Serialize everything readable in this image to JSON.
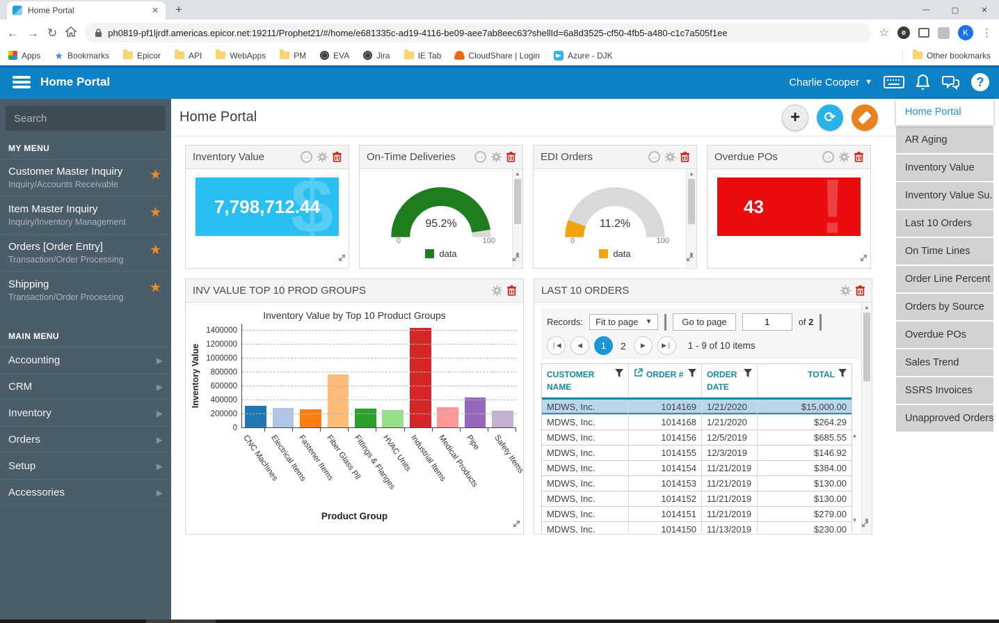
{
  "browser": {
    "tab_title": "Home Portal",
    "url": "ph0819-pf1ljrdf.americas.epicor.net:19211/Prophet21/#/home/e681335c-ad19-4116-be09-aee7ab8eec63?shellId=6a8d3525-cf50-4fb5-a480-c1c7a505f1ee",
    "avatar_letter": "K",
    "extension_letter": "e",
    "bookmarks": [
      {
        "label": "Apps",
        "icon": "apps-grid"
      },
      {
        "label": "Bookmarks",
        "icon": "star-blue"
      },
      {
        "label": "Epicor",
        "icon": "folder"
      },
      {
        "label": "API",
        "icon": "folder"
      },
      {
        "label": "WebApps",
        "icon": "folder"
      },
      {
        "label": "PM",
        "icon": "folder"
      },
      {
        "label": "EVA",
        "icon": "globe"
      },
      {
        "label": "Jira",
        "icon": "globe"
      },
      {
        "label": "IE Tab",
        "icon": "folder"
      },
      {
        "label": "CloudShare | Login",
        "icon": "cloudshare"
      },
      {
        "label": "Azure - DJK",
        "icon": "azure"
      }
    ],
    "other_bookmarks": "Other bookmarks"
  },
  "app_header": {
    "title": "Home Portal",
    "user": "Charlie Cooper"
  },
  "sidebar": {
    "search_placeholder": "Search",
    "my_menu_title": "MY MENU",
    "my_menu": [
      {
        "title": "Customer Master Inquiry",
        "subtitle": "Inquiry/Accounts Receivable"
      },
      {
        "title": "Item Master Inquiry",
        "subtitle": "Inquiry/Inventory Management"
      },
      {
        "title": "Orders [Order Entry]",
        "subtitle": "Transaction/Order Processing"
      },
      {
        "title": "Shipping",
        "subtitle": "Transaction/Order Processing"
      }
    ],
    "main_menu_title": "MAIN MENU",
    "main_menu": [
      "Accounting",
      "CRM",
      "Inventory",
      "Orders",
      "Setup",
      "Accessories"
    ]
  },
  "page": {
    "title": "Home Portal"
  },
  "widgets": {
    "inventory_value": {
      "title": "Inventory Value",
      "value": "7,798,712.44",
      "accent": "#29bff0",
      "watermark": "$"
    },
    "on_time": {
      "title": "On-Time Deliveries",
      "percent": 95.2,
      "display": "95.2%",
      "min": "0",
      "max": "100",
      "legend": "data",
      "color": "#1e7e1e"
    },
    "edi": {
      "title": "EDI Orders",
      "percent": 11.2,
      "display": "11.2%",
      "min": "0",
      "max": "100",
      "legend": "data",
      "color": "#f0a30c"
    },
    "overdue": {
      "title": "Overdue POs",
      "value": "43",
      "accent": "#ea0d0d",
      "watermark": "!"
    },
    "prod_groups": {
      "title": "INV VALUE TOP 10 PROD GROUPS",
      "chart_data": {
        "type": "bar",
        "title": "Inventory Value by Top 10 Product Groups",
        "xlabel": "Product Group",
        "ylabel": "Inventory Value",
        "ylim": [
          0,
          1500000
        ],
        "yticks": [
          0,
          200000,
          400000,
          600000,
          800000,
          1000000,
          1200000,
          1400000
        ],
        "grid": "dashed horizontal",
        "legend_position": "none",
        "categories": [
          "CNC Machines",
          "Electrical Items",
          "Fastener Items",
          "Fiber Glass Pll",
          "Fittings & Flanges",
          "HVAC Units",
          "Industrial Items",
          "Medical Products",
          "Pipe",
          "Safety Items"
        ],
        "values": [
          320000,
          290000,
          275000,
          770000,
          285000,
          260000,
          1440000,
          300000,
          440000,
          250000
        ],
        "colors": [
          "#1f77b4",
          "#aec7e8",
          "#ff7f0e",
          "#ffbb78",
          "#2ca02c",
          "#98df8a",
          "#d62728",
          "#ff9896",
          "#9467bd",
          "#c5b0d5"
        ]
      }
    },
    "last_orders": {
      "title": "LAST 10 ORDERS",
      "records_label": "Records:",
      "page_size_value": "Fit to page",
      "goto_button": "Go to page",
      "page_input": "1",
      "of_label": "of",
      "page_count": "2",
      "pages": [
        "1",
        "2"
      ],
      "active_page": "1",
      "range_summary": "1 - 9 of 10 items",
      "columns": [
        "CUSTOMER NAME",
        "ORDER #",
        "ORDER DATE",
        "TOTAL"
      ],
      "rows": [
        {
          "customer": "MDWS, Inc.",
          "order": "1014169",
          "date": "1/21/2020",
          "total": "$15,000.00",
          "selected": true
        },
        {
          "customer": "MDWS, Inc.",
          "order": "1014168",
          "date": "1/21/2020",
          "total": "$264.29"
        },
        {
          "customer": "MDWS, Inc.",
          "order": "1014156",
          "date": "12/5/2019",
          "total": "$685.55"
        },
        {
          "customer": "MDWS, Inc.",
          "order": "1014155",
          "date": "12/3/2019",
          "total": "$146.92"
        },
        {
          "customer": "MDWS, Inc.",
          "order": "1014154",
          "date": "11/21/2019",
          "total": "$384.00"
        },
        {
          "customer": "MDWS, Inc.",
          "order": "1014153",
          "date": "11/21/2019",
          "total": "$130.00"
        },
        {
          "customer": "MDWS, Inc.",
          "order": "1014152",
          "date": "11/21/2019",
          "total": "$130.00"
        },
        {
          "customer": "MDWS, Inc.",
          "order": "1014151",
          "date": "11/21/2019",
          "total": "$279.00"
        },
        {
          "customer": "MDWS, Inc.",
          "order": "1014150",
          "date": "11/13/2019",
          "total": "$230.00"
        }
      ]
    }
  },
  "right_panel": {
    "items": [
      {
        "label": "Home Portal",
        "active": true
      },
      {
        "label": "AR Aging"
      },
      {
        "label": "Inventory Value"
      },
      {
        "label": "Inventory Value Su..."
      },
      {
        "label": "Last 10 Orders"
      },
      {
        "label": "On Time Lines"
      },
      {
        "label": "Order Line Percent"
      },
      {
        "label": "Orders by Source"
      },
      {
        "label": "Overdue POs"
      },
      {
        "label": "Sales Trend"
      },
      {
        "label": "SSRS Invoices"
      },
      {
        "label": "Unapproved Orders"
      }
    ]
  }
}
